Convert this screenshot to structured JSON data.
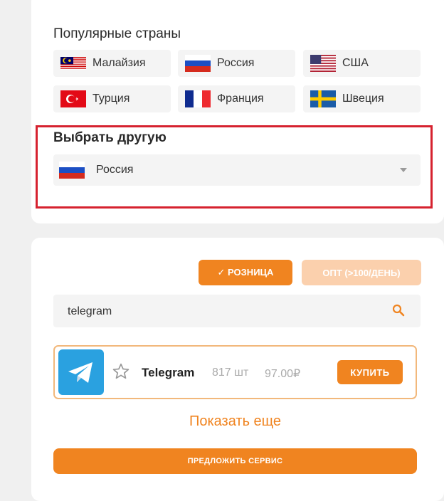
{
  "popular": {
    "title": "Популярные страны",
    "countries": [
      {
        "label": "Малайзия",
        "flag": "malaysia-flag"
      },
      {
        "label": "Россия",
        "flag": "russia-flag"
      },
      {
        "label": "США",
        "flag": "usa-flag"
      },
      {
        "label": "Турция",
        "flag": "turkey-flag"
      },
      {
        "label": "Франция",
        "flag": "france-flag"
      },
      {
        "label": "Швеция",
        "flag": "sweden-flag"
      }
    ]
  },
  "other": {
    "title": "Выбрать другую",
    "selected": "Россия",
    "selected_flag": "russia-flag"
  },
  "mode": {
    "retail": "✓ РОЗНИЦА",
    "wholesale": "ОПТ (>100/ДЕНЬ)"
  },
  "search": {
    "value": "telegram"
  },
  "service": {
    "name": "Telegram",
    "quantity": "817 шт",
    "price": "97.00₽",
    "buy_label": "КУПИТЬ",
    "icon": "telegram-icon"
  },
  "show_more": "Показать еще",
  "suggest": "ПРЕДЛОЖИТЬ СЕРВИС",
  "colors": {
    "accent": "#f08420",
    "highlight": "#d6222f"
  }
}
